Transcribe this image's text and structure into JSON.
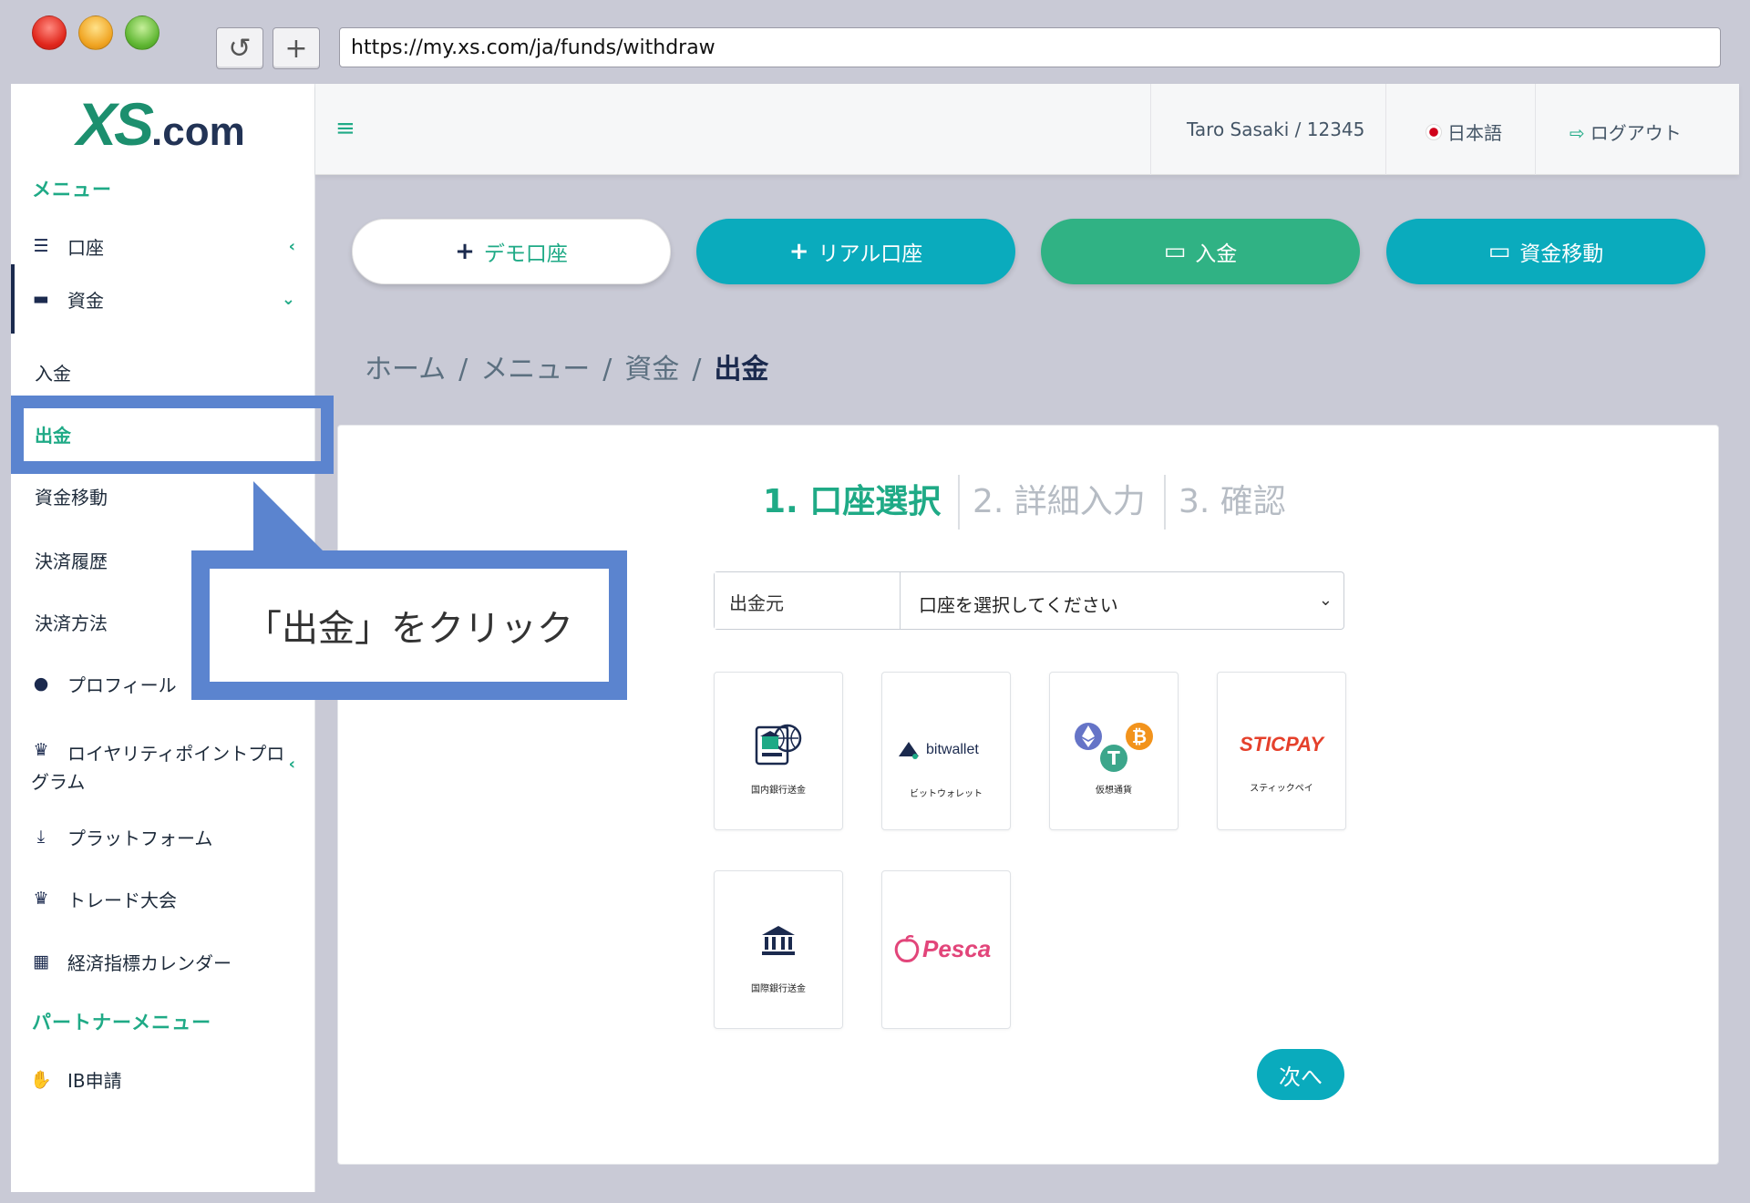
{
  "browser": {
    "url": "https://my.xs.com/ja/funds/withdraw",
    "reload_glyph": "↺",
    "newtab_glyph": "+"
  },
  "brand": {
    "logo_main": "XS",
    "logo_suffix": ".com",
    "accent": "#1faa86",
    "navy": "#1b2a4e",
    "teal": "#0aabbd"
  },
  "sidebar": {
    "menu_heading": "メニュー",
    "account": {
      "label": "口座",
      "icon": "list-icon"
    },
    "funds": {
      "label": "資金",
      "icon": "wallet-icon"
    },
    "funds_sub": {
      "deposit": "入金",
      "withdraw": "出金",
      "transfer": "資金移動",
      "history": "決済履歴",
      "methods": "決済方法"
    },
    "profile": {
      "label": "プロフィール",
      "icon": "user-icon"
    },
    "loyalty": {
      "label_line1": "ロイヤリティポイントプロ",
      "label_line2": "グラム",
      "icon": "trophy-icon"
    },
    "platform": {
      "label": "プラットフォーム",
      "icon": "download-icon"
    },
    "contest": {
      "label": "トレード大会",
      "icon": "trophy-icon"
    },
    "calendar": {
      "label": "経済指標カレンダー",
      "icon": "calendar-icon"
    },
    "partner_heading": "パートナーメニュー",
    "ib": {
      "label": "IB申請",
      "icon": "handshake-icon"
    }
  },
  "callout": {
    "text": "「出金」をクリック"
  },
  "header": {
    "user": "Taro Sasaki / 12345",
    "language": "日本語",
    "logout": "ログアウト"
  },
  "actions": {
    "demo": "デモ口座",
    "real": "リアル口座",
    "deposit": "入金",
    "transfer": "資金移動"
  },
  "breadcrumb": {
    "home": "ホーム",
    "menu": "メニュー",
    "funds": "資金",
    "current": "出金",
    "separator": "/"
  },
  "steps": {
    "step1": "1. 口座選択",
    "step2": "2. 詳細入力",
    "step3": "3. 確認"
  },
  "form": {
    "source_label": "出金元",
    "source_placeholder": "口座を選択してください"
  },
  "methods": {
    "domestic_bank": "国内銀行送金",
    "bitwallet_logo": "bitwallet",
    "bitwallet_caption": "ビットウォレット",
    "crypto": "仮想通貨",
    "sticpay_logo": "STICPAY",
    "sticpay_caption": "スティックペイ",
    "intl_bank": "国際銀行送金",
    "pesca_logo": "Pesca"
  },
  "next_button": "次へ"
}
